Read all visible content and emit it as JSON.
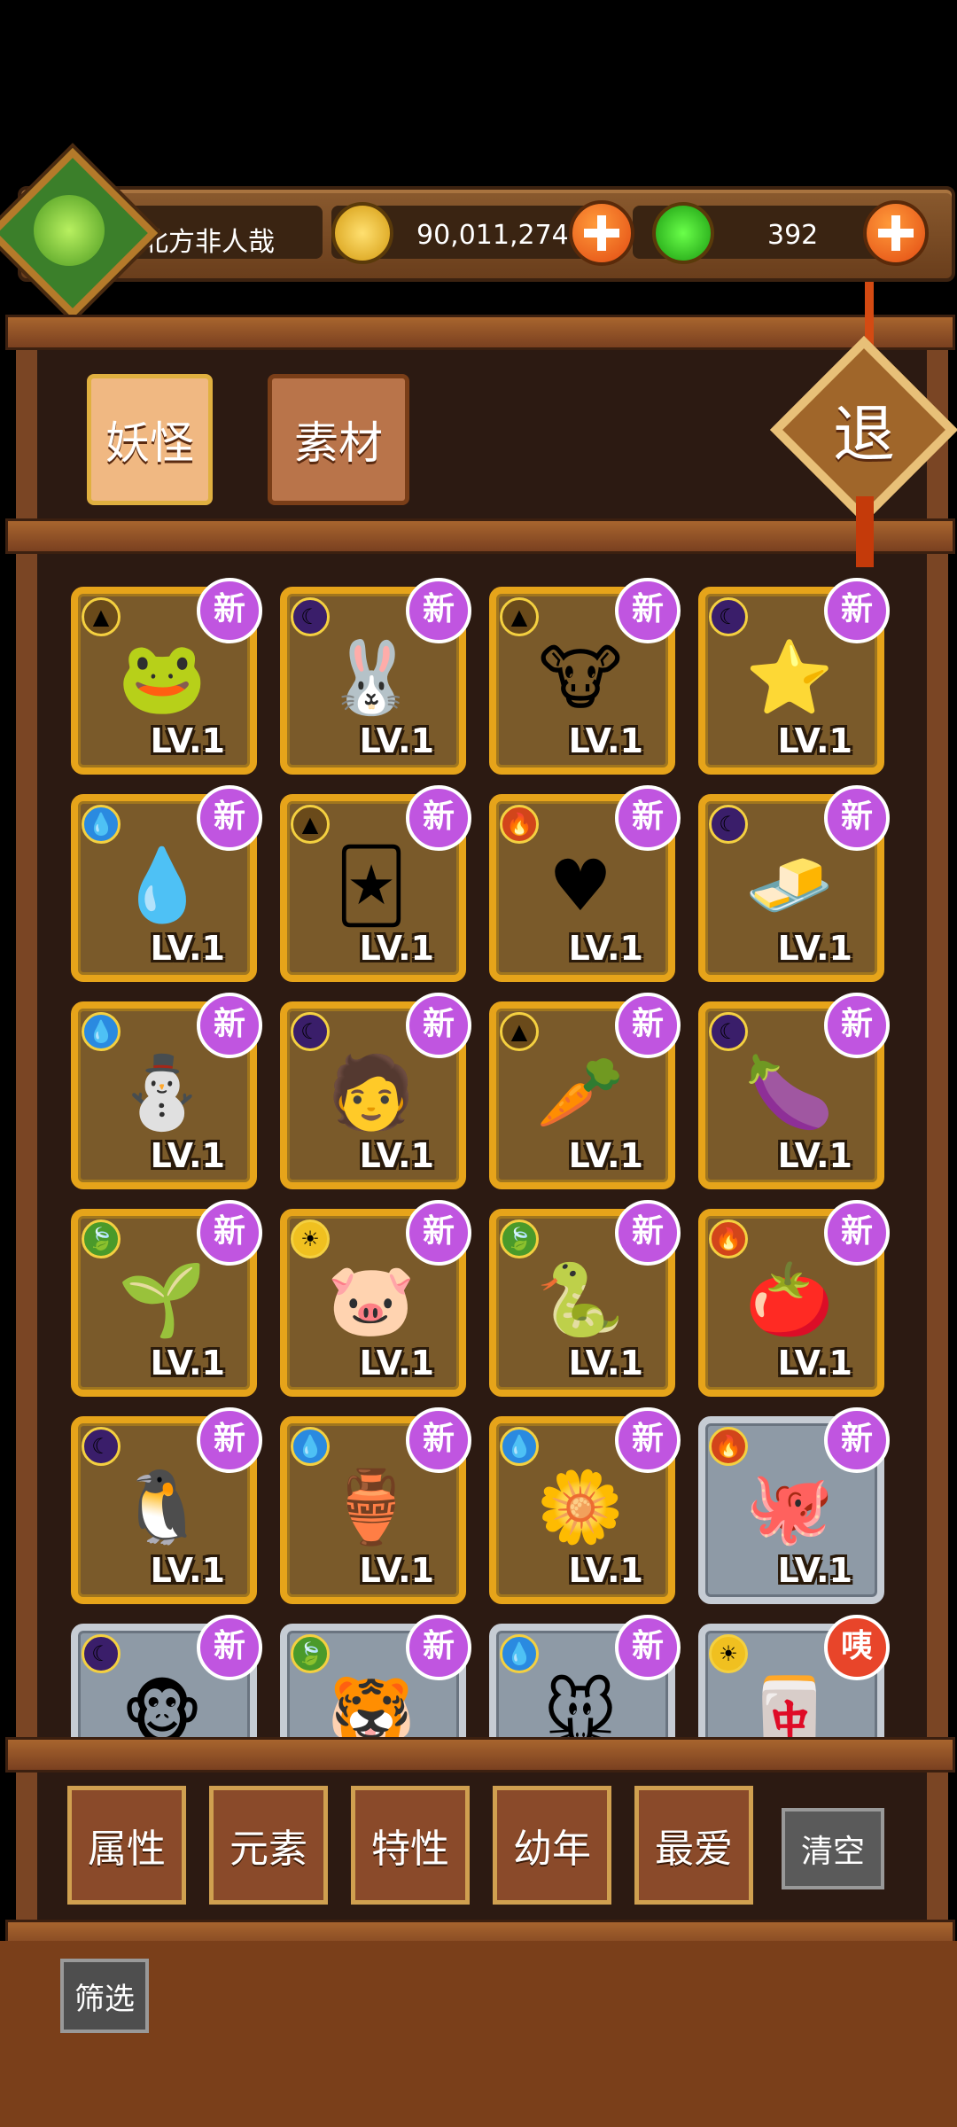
{
  "player": {
    "name": "北方非人哉",
    "coins": "90,011,274",
    "jade": "392"
  },
  "tabs": [
    {
      "label": "妖怪"
    },
    {
      "label": "素材"
    }
  ],
  "quit_label": "退",
  "cards": [
    {
      "elem": "earth",
      "elem_icon": "▲",
      "badge": "新",
      "level": "LV.1",
      "art": "🐸",
      "silver": false
    },
    {
      "elem": "dark",
      "elem_icon": "☾",
      "badge": "新",
      "level": "LV.1",
      "art": "🐰",
      "silver": false
    },
    {
      "elem": "earth",
      "elem_icon": "▲",
      "badge": "新",
      "level": "LV.1",
      "art": "🐮",
      "silver": false
    },
    {
      "elem": "dark",
      "elem_icon": "☾",
      "badge": "新",
      "level": "LV.1",
      "art": "⭐",
      "silver": false
    },
    {
      "elem": "water",
      "elem_icon": "💧",
      "badge": "新",
      "level": "LV.1",
      "art": "💧",
      "silver": false
    },
    {
      "elem": "earth",
      "elem_icon": "▲",
      "badge": "新",
      "level": "LV.1",
      "art": "🃏",
      "silver": false
    },
    {
      "elem": "fire",
      "elem_icon": "🔥",
      "badge": "新",
      "level": "LV.1",
      "art": "♥",
      "silver": false
    },
    {
      "elem": "dark",
      "elem_icon": "☾",
      "badge": "新",
      "level": "LV.1",
      "art": "🧈",
      "silver": false
    },
    {
      "elem": "water",
      "elem_icon": "💧",
      "badge": "新",
      "level": "LV.1",
      "art": "⛄",
      "silver": false
    },
    {
      "elem": "dark",
      "elem_icon": "☾",
      "badge": "新",
      "level": "LV.1",
      "art": "🧑",
      "silver": false
    },
    {
      "elem": "earth",
      "elem_icon": "▲",
      "badge": "新",
      "level": "LV.1",
      "art": "🥕",
      "silver": false
    },
    {
      "elem": "dark",
      "elem_icon": "☾",
      "badge": "新",
      "level": "LV.1",
      "art": "🍆",
      "silver": false
    },
    {
      "elem": "wood",
      "elem_icon": "🍃",
      "badge": "新",
      "level": "LV.1",
      "art": "🌱",
      "silver": false
    },
    {
      "elem": "light",
      "elem_icon": "☀",
      "badge": "新",
      "level": "LV.1",
      "art": "🐷",
      "silver": false
    },
    {
      "elem": "wood",
      "elem_icon": "🍃",
      "badge": "新",
      "level": "LV.1",
      "art": "🐍",
      "silver": false
    },
    {
      "elem": "fire",
      "elem_icon": "🔥",
      "badge": "新",
      "level": "LV.1",
      "art": "🍅",
      "silver": false
    },
    {
      "elem": "dark",
      "elem_icon": "☾",
      "badge": "新",
      "level": "LV.1",
      "art": "🐧",
      "silver": false
    },
    {
      "elem": "water",
      "elem_icon": "💧",
      "badge": "新",
      "level": "LV.1",
      "art": "🏺",
      "silver": false
    },
    {
      "elem": "water",
      "elem_icon": "💧",
      "badge": "新",
      "level": "LV.1",
      "art": "🌼",
      "silver": false
    },
    {
      "elem": "fire",
      "elem_icon": "🔥",
      "badge": "新",
      "level": "LV.1",
      "art": "🐙",
      "silver": true
    },
    {
      "elem": "dark",
      "elem_icon": "☾",
      "badge": "新",
      "level": "",
      "art": "🐵",
      "silver": true
    },
    {
      "elem": "wood",
      "elem_icon": "🍃",
      "badge": "新",
      "level": "",
      "art": "🐯",
      "silver": true
    },
    {
      "elem": "water",
      "elem_icon": "💧",
      "badge": "新",
      "level": "",
      "art": "🐭",
      "silver": true
    },
    {
      "elem": "light",
      "elem_icon": "☀",
      "badge": "咦",
      "level": "",
      "art": "🀄",
      "silver": true
    }
  ],
  "filters": [
    {
      "label": "属性"
    },
    {
      "label": "元素"
    },
    {
      "label": "特性"
    },
    {
      "label": "幼年"
    },
    {
      "label": "最爱"
    }
  ],
  "clear_label": "清空",
  "filter_label": "筛选",
  "colors": {
    "gold_border": "#e6a41a",
    "new_badge": "#c055e0",
    "accent_red": "#e8452a"
  }
}
